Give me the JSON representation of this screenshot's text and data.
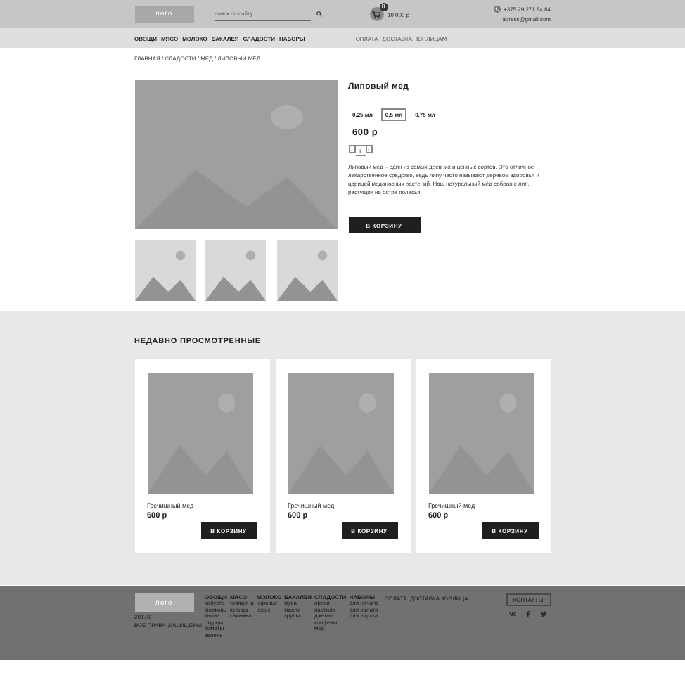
{
  "header": {
    "logo": "лого",
    "search": {
      "placeholder": "поиск по сайту"
    },
    "cart": {
      "count": "0",
      "total": "10 000 р"
    },
    "phone": "+375 29 271 84 84",
    "email": "adress@gmail.com"
  },
  "nav": {
    "categories": [
      "ОВОЩИ",
      "МЯСО",
      "МОЛОКО",
      "БАКАЛЕЯ",
      "СЛАДОСТИ",
      "НАБОРЫ"
    ],
    "info": [
      "ОПЛАТА",
      "ДОСТАВКА",
      "ЮР.ЛИЦАМ"
    ]
  },
  "breadcrumbs": "ГЛАВНАЯ / СЛАДОСТИ / МЕД / ЛИПОВЫЙ МЕД",
  "product": {
    "title": "Липовый мед",
    "sizes": [
      {
        "label": "0,25 мл",
        "selected": false
      },
      {
        "label": "0,5 мл",
        "selected": true
      },
      {
        "label": "0,75 мл",
        "selected": false
      }
    ],
    "price": "600 р",
    "quantity": {
      "minus": "-",
      "value": "1",
      "plus": "+"
    },
    "description": "Липовый мёд – один из самых древних и ценных сортов. Это отличное лекарственное средство, ведь липу часто называют деревом здоровья и царицей медоносных растений. Наш натуральный мёд собран с лип, растущих на остре полесья.",
    "button": "В КОРЗИНУ"
  },
  "recent": {
    "title": "НЕДАВНО ПРОСМОТРЕННЫЕ",
    "items": [
      {
        "name": "Гречишный мед",
        "price": "600 р",
        "button": "В КОРЗИНУ"
      },
      {
        "name": "Гречишный мед",
        "price": "600 р",
        "button": "В КОРЗИНУ"
      },
      {
        "name": "Гречишный мед",
        "price": "600 р",
        "button": "В КОРЗИНУ"
      }
    ]
  },
  "footer": {
    "logo": "лого",
    "copyright": [
      "2017©",
      "ВСЕ ПРАВА ЗАЩИЩЕНЫ"
    ],
    "columns": [
      {
        "title": "ОВОЩИ",
        "links": [
          "капуста",
          "морковь",
          "тыква",
          "огурцы",
          "томаты",
          "зелень"
        ]
      },
      {
        "title": "МЯСО",
        "links": [
          "говядина",
          "курица",
          "свинина"
        ]
      },
      {
        "title": "МОЛОКО",
        "links": [
          "коровье",
          "козье"
        ]
      },
      {
        "title": "БАКАЛЕЯ",
        "links": [
          "мука",
          "масло",
          "крупы"
        ]
      },
      {
        "title": "СЛАДОСТИ",
        "links": [
          "орехи",
          "пастила",
          "джемы",
          "конфеты",
          "мед"
        ]
      },
      {
        "title": "НАБОРЫ",
        "links": [
          "для начала",
          "для салата",
          "для пирога"
        ]
      }
    ],
    "info": [
      "ОПЛАТА",
      "ДОСТАВКА",
      "ЮР.ЛИЦА"
    ],
    "contacts": "КОНТАКТЫ"
  }
}
